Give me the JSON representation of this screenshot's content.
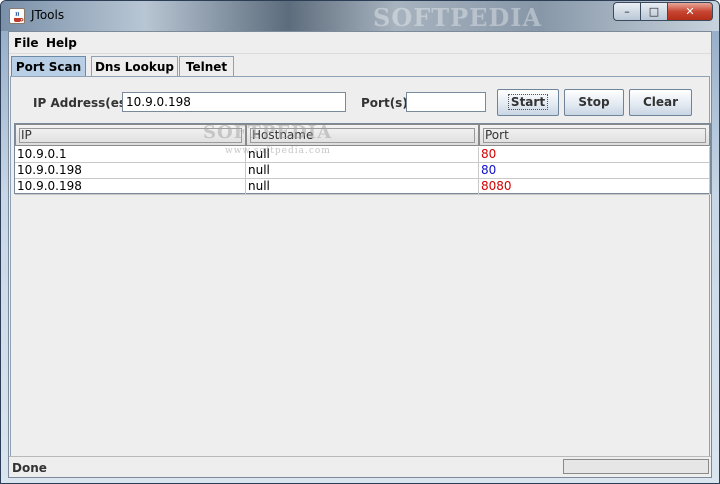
{
  "window": {
    "title": "JTools",
    "controls": {
      "minimize": "–",
      "maximize": "□",
      "close": "✕"
    }
  },
  "menu": {
    "items": [
      "File",
      "Help"
    ]
  },
  "tabs": [
    {
      "label": "Port Scan",
      "active": true
    },
    {
      "label": "Dns Lookup",
      "active": false
    },
    {
      "label": "Telnet",
      "active": false
    }
  ],
  "form": {
    "ip_label": "IP Address(es)",
    "ip_value": "10.9.0.198",
    "ports_label": "Port(s)",
    "ports_value": "",
    "start_label": "Start",
    "stop_label": "Stop",
    "clear_label": "Clear"
  },
  "table": {
    "headers": [
      "IP",
      "Hostname",
      "Port"
    ],
    "rows": [
      {
        "ip": "10.9.0.1",
        "hostname": "null",
        "port": "80",
        "port_color": "#d40000"
      },
      {
        "ip": "10.9.0.198",
        "hostname": "null",
        "port": "80",
        "port_color": "#1010c8"
      },
      {
        "ip": "10.9.0.198",
        "hostname": "null",
        "port": "8080",
        "port_color": "#d40000"
      }
    ]
  },
  "status": {
    "text": "Done",
    "progress": 0
  },
  "watermarks": {
    "title_bar": "SOFTPEDIA",
    "table_large": "SOFTPEDIA",
    "table_small": "www.softpedia.com"
  }
}
